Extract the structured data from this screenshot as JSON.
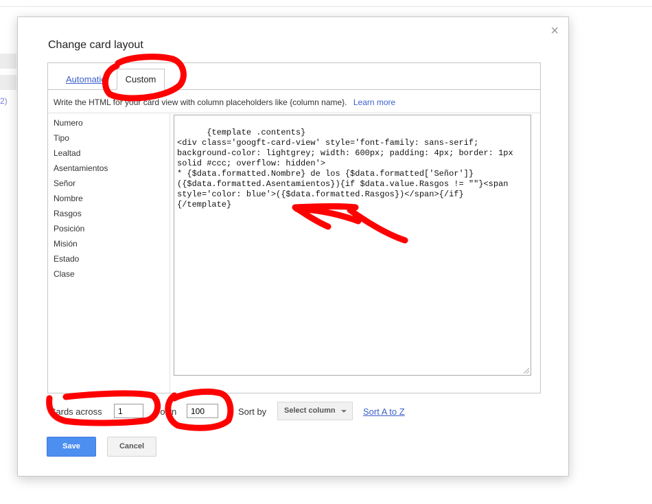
{
  "background": {
    "count_fragment": "2)"
  },
  "dialog": {
    "title": "Change card layout",
    "close_glyph": "×",
    "tabs": [
      {
        "label": "Automatic",
        "active": false
      },
      {
        "label": "Custom",
        "active": true
      }
    ],
    "hint": "Write the HTML for your card view with column placeholders like {column name}.",
    "learn_more": "Learn more",
    "columns": [
      "Numero",
      "Tipo",
      "Lealtad",
      "Asentamientos",
      "Señor",
      "Nombre",
      "Rasgos",
      "Posición",
      "Misión",
      "Estado",
      "Clase"
    ],
    "template_code": "{template .contents}\n<div class='googft-card-view' style='font-family: sans-serif; background-color: lightgrey; width: 600px; padding: 4px; border: 1px solid #ccc; overflow: hidden'>\n* {$data.formatted.Nombre} de los {$data.formatted['Señor']} ({$data.formatted.Asentamientos}){if $data.value.Rasgos != \"\"}<span style='color: blue'>({$data.formatted.Rasgos})</span>{/if}\n{/template}",
    "controls": {
      "cards_across_label": "Cards across",
      "cards_across_value": "1",
      "down_label": "Down",
      "down_value": "100",
      "sort_by_label": "Sort by",
      "select_column": "Select column",
      "sort_order": "Sort A to Z"
    },
    "buttons": {
      "save": "Save",
      "cancel": "Cancel"
    }
  },
  "colors": {
    "link": "#3b5fcc",
    "primary_button": "#4d8ff0",
    "annotation": "#ff0000"
  }
}
